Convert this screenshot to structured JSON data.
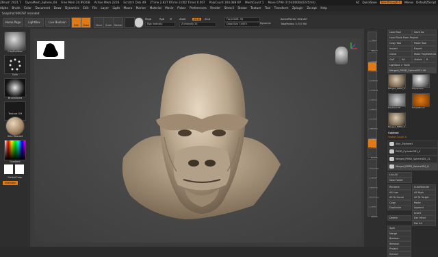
{
  "title_bar": {
    "items": [
      "ZBrush 2021.7",
      "DynaMesh_Sphere_64",
      "Free Mem 24.992GB",
      "Active Mem 2226",
      "Scratch Disk 49",
      "ZTime 2.827 RTime 2.002 Timer 0.007",
      "PolyCount 304.089 KP",
      "MeshCount 1",
      "Move 0790 (X:0)(0000)(0245mh)"
    ],
    "right": [
      "AC",
      "QuickSave",
      "See-through 0",
      "Menus",
      "DefaultZScript"
    ]
  },
  "menu_bar": [
    "Alpha",
    "Brush",
    "Color",
    "Document",
    "Draw",
    "Dynamics",
    "Edit",
    "File",
    "Layer",
    "Light",
    "Macro",
    "Marker",
    "Material",
    "Movie",
    "Picker",
    "Preferences",
    "Render",
    "Stencil",
    "Stroke",
    "Texture",
    "Tool",
    "Transform",
    "Zplugin",
    "Zscript",
    "Help"
  ],
  "snapshot": "Snapshot:900787 recorded.",
  "toolbar": {
    "home_page": "Home Page",
    "lightbox": "LightBox",
    "live_boolean": "Live Boolean",
    "edit": "Edit",
    "draw": "Draw",
    "move": "Move",
    "scale": "Scale",
    "rotate": "Rotate",
    "mrgb": "Mrgb",
    "rgb": "Rgb",
    "m": "M",
    "zadd": "Zadd",
    "zsub": "Zsub",
    "zcut": "Zcut",
    "rgb_intensity": "Rgb Intensity",
    "z_intensity": "Z Intensity 33",
    "focal_shift": "Focal Shift -94",
    "draw_size": "Draw Size 7.4675",
    "dynamic": "Dynamic",
    "active_points": "ActivePoints: 304,087",
    "total_points": "TotalPoints: 5.757 Mil"
  },
  "left_shelf": {
    "brush": "ClayBuildup",
    "stroke": "Dots",
    "alpha": "BrushAlpha",
    "texture": "Texture Off",
    "material": "Skin Shade4",
    "gradient": "Gradient",
    "switch_color": "SwitchColor",
    "alternate": "Alternate"
  },
  "right_shelf": [
    "BPR",
    "SPix 3",
    "Scroll",
    "Zoom",
    "Actual",
    "AAHalf",
    "Persp",
    "Floor",
    "Local",
    "Frame",
    "Move",
    "Scale",
    "Rotate",
    "Line Fill",
    "PolyF",
    "Transp",
    "Dynamic",
    "Solo",
    "Xpose"
  ],
  "tool_palette": {
    "top_buttons": [
      [
        "Load Tool",
        "Save As"
      ],
      [
        "Load Tools From Project"
      ],
      [
        "Copy Tool",
        "Paste Tool"
      ],
      [
        "Import",
        "Export"
      ],
      [
        "Clone",
        "Make PolyMesh3D"
      ],
      [
        "GoZ",
        "All",
        "Visible",
        "R"
      ],
      [
        "Lightbox > Tools"
      ]
    ],
    "current_tool": "Merged_PM3D_Sphere3D1 48",
    "tool_thumbs": [
      "Merged_PM3D_S...",
      "PolySphere",
      "PolyMesh3D",
      "SimpleBrush",
      "Merged_PM3D_S..."
    ],
    "subtool_header": "Subtool",
    "visible_count": "Visible Count 4",
    "subtools": [
      "Skin_ZSphere1",
      "PM3D_Cylinder3D1_4",
      "Merged_PM3D_Sphere3D1_21",
      "Merged_PM3D_Sphere3D1_8"
    ],
    "list_all": "List All",
    "new_folder": "New Folder",
    "actions": [
      [
        "Rename",
        "AutoReorder"
      ],
      [
        "All Low",
        "All High"
      ],
      [
        "All To Home",
        "All To Target"
      ],
      [
        "Copy",
        "Paste"
      ],
      [
        "Duplicate",
        "Append"
      ],
      [
        "",
        "Insert"
      ],
      [
        "Delete",
        "Del Other"
      ],
      [
        "",
        "Del All"
      ],
      [
        "Split",
        ""
      ],
      [
        "Merge",
        ""
      ],
      [
        "Boolean",
        ""
      ],
      [
        "Remesh",
        ""
      ],
      [
        "Project",
        ""
      ],
      [
        "Extract",
        ""
      ]
    ]
  },
  "colors": {
    "accent": "#e07a16",
    "clay": "#b9a58c",
    "background": "#2b2b2b"
  }
}
